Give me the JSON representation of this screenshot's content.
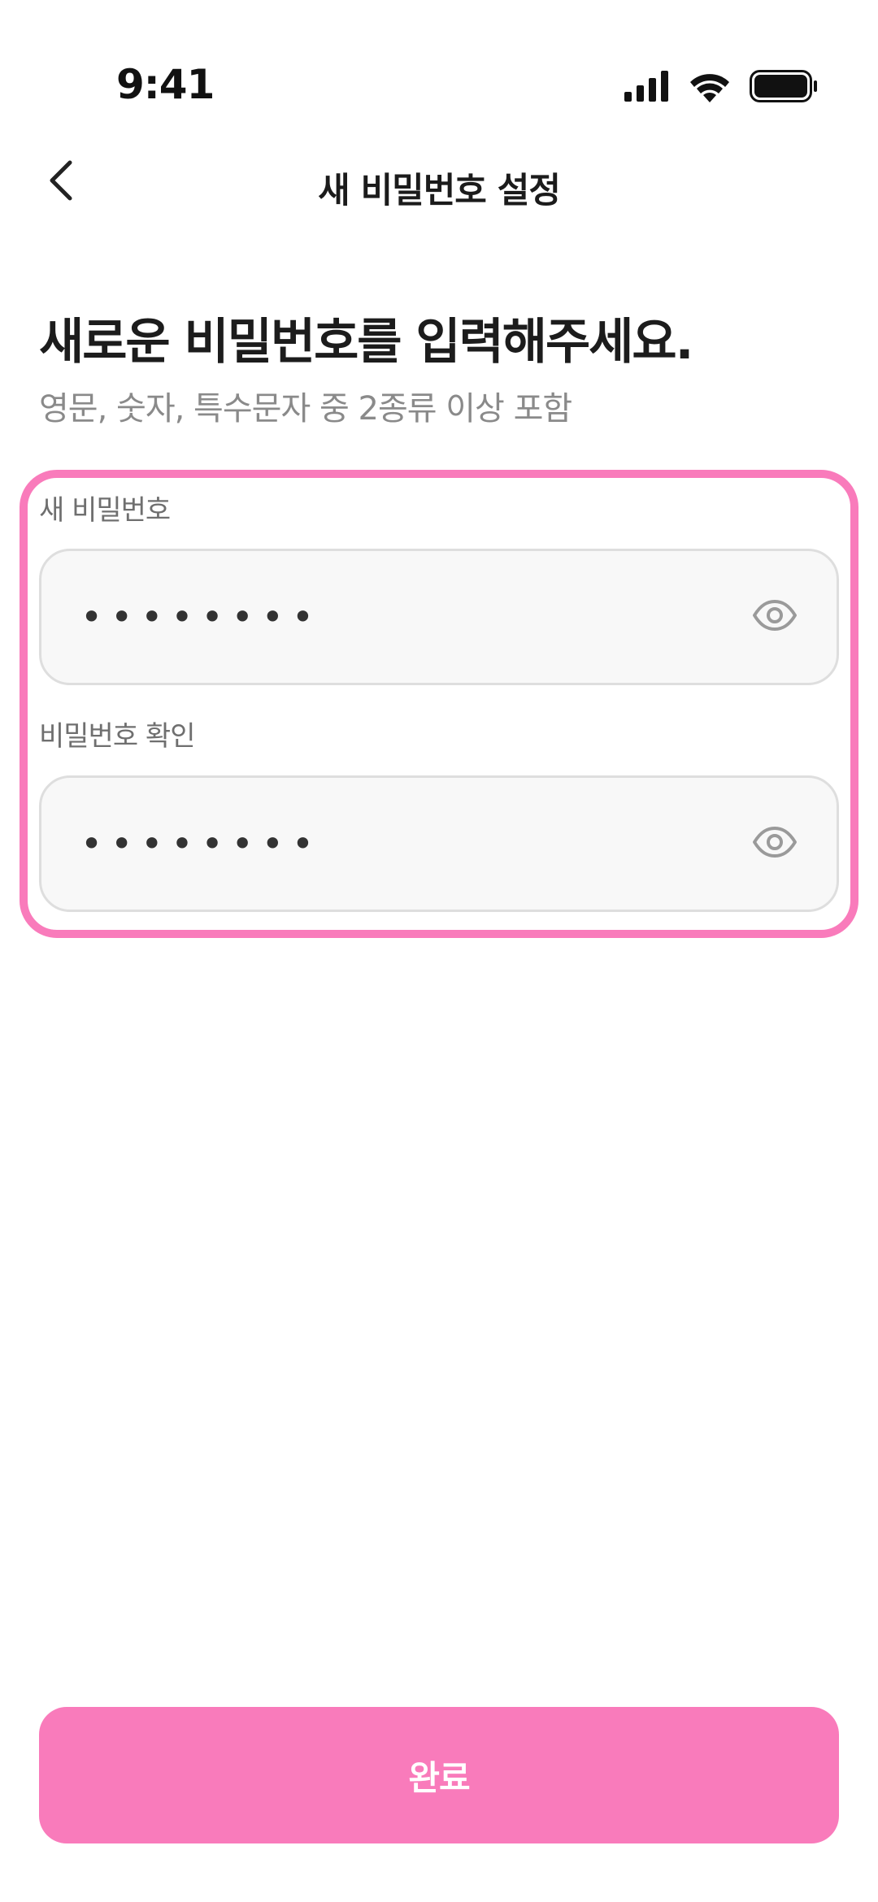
{
  "status_bar": {
    "time": "9:41",
    "icons": [
      "cellular-signal-icon",
      "wifi-icon",
      "battery-icon"
    ]
  },
  "header": {
    "title": "새 비밀번호 설정",
    "back_icon": "chevron-left-icon"
  },
  "content": {
    "headline": "새로운 비밀번호를 입력해주세요.",
    "subline": "영문, 숫자, 특수문자 중 2종류 이상 포함"
  },
  "form": {
    "new_password": {
      "label": "새 비밀번호",
      "value": "••••••••",
      "toggle_icon": "eye-icon"
    },
    "confirm_password": {
      "label": "비밀번호 확인",
      "value": "••••••••",
      "toggle_icon": "eye-icon"
    }
  },
  "actions": {
    "submit_label": "완료"
  },
  "colors": {
    "accent": "#f97bbb",
    "input_background": "#f8f8f8",
    "input_border": "#dedede",
    "muted_text": "#8a8a8a"
  }
}
